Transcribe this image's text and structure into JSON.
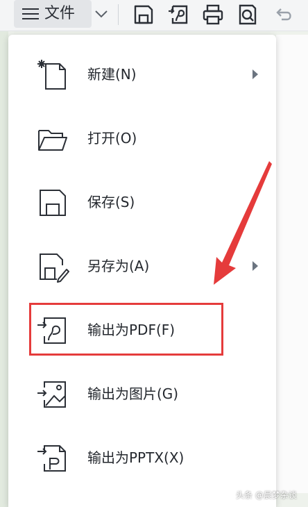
{
  "toolbar": {
    "file_label": "文件",
    "icons": [
      "hamburger-icon",
      "chevron-down-icon",
      "save-icon",
      "export-pdf-icon",
      "print-icon",
      "preview-icon",
      "undo-icon"
    ]
  },
  "menu": {
    "items": [
      {
        "label": "新建(N)",
        "icon": "new-file-icon",
        "has_submenu": true
      },
      {
        "label": "打开(O)",
        "icon": "folder-open-icon",
        "has_submenu": false
      },
      {
        "label": "保存(S)",
        "icon": "save-icon",
        "has_submenu": false
      },
      {
        "label": "另存为(A)",
        "icon": "save-as-icon",
        "has_submenu": true
      },
      {
        "label": "输出为PDF(F)",
        "icon": "export-pdf-icon",
        "has_submenu": false,
        "highlighted": true
      },
      {
        "label": "输出为图片(G)",
        "icon": "export-image-icon",
        "has_submenu": false
      },
      {
        "label": "输出为PPTX(X)",
        "icon": "export-pptx-icon",
        "has_submenu": false
      }
    ]
  },
  "annotation": {
    "color": "#e53b3b"
  },
  "watermark": "头条 @晨梦杂谈"
}
